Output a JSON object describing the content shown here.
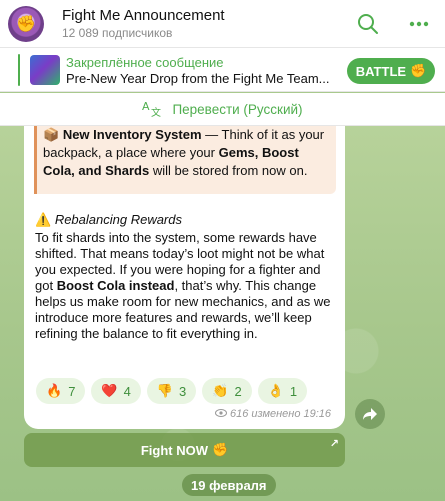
{
  "header": {
    "title": "Fight Me Announcement",
    "subtitle": "12 089 подписчиков"
  },
  "pinned": {
    "label": "Закреплённое сообщение",
    "text": "Pre-New Year Drop from the Fight Me Team...",
    "button_label": "BATTLE",
    "button_emoji": "✊"
  },
  "translate": {
    "label": "Перевести (Русский)"
  },
  "message": {
    "quote_emoji": "📦",
    "quote_bold": "New Inventory System",
    "quote_text_1": " — Think of it as your backpack, a place where your ",
    "quote_bold_2": "Gems, Boost Cola, and Shards",
    "quote_text_2": " will be stored from now on.",
    "section_emoji": "⚠️",
    "section_title": "Rebalancing Rewards",
    "body_1": "To fit shards into the system, some rewards have shifted. That means today’s loot might not be what you expected. If you were hoping for a fighter and got ",
    "body_bold": "Boost Cola instead",
    "body_2": ", that’s why. This change helps us make room for new mechanics, and as we introduce more features and rewards, we’ll keep refining the balance to fit everything in.",
    "views": "616",
    "edited": "изменено",
    "time": "19:16"
  },
  "reactions": [
    {
      "emoji": "🔥",
      "count": "7"
    },
    {
      "emoji": "❤️",
      "count": "4"
    },
    {
      "emoji": "👎",
      "count": "3"
    },
    {
      "emoji": "👏",
      "count": "2"
    },
    {
      "emoji": "👌",
      "count": "1"
    }
  ],
  "fight_button": {
    "label": "Fight NOW",
    "emoji": "✊"
  },
  "date_separator": "19 февраля",
  "colors": {
    "accent": "#4fae4e",
    "quote_border": "#e0925a",
    "quote_bg": "#fbece0"
  }
}
